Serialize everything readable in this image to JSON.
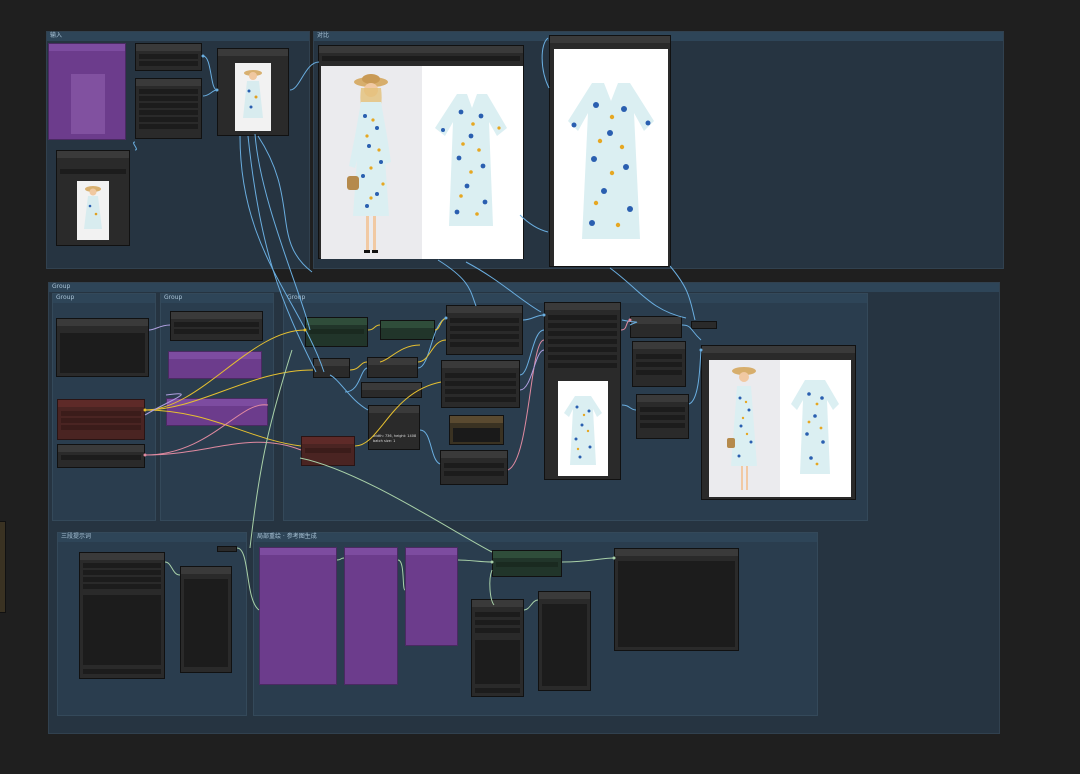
{
  "groups": {
    "input": "输入",
    "compare": "对比",
    "output": "Output",
    "main": "Group",
    "sub1": "Group",
    "sub2": "Group",
    "sub3": "Group",
    "bottom_left": "三段提示词",
    "bottom_right": "局部重绘 · 参考图生成"
  },
  "node_text": {
    "size_info": "width: 736, height: 1408\nbatch size: 1"
  },
  "icons": {
    "dress_front": "dress-icon",
    "model": "model-icon"
  },
  "colors": {
    "background": "#1f1f1f",
    "group": "#263441",
    "wire_blue": "#6aaee0",
    "wire_yellow": "#e6c030",
    "wire_pink": "#e08aa0",
    "wire_lavender": "#b0a0e0",
    "wire_green": "#a8d0a8"
  }
}
